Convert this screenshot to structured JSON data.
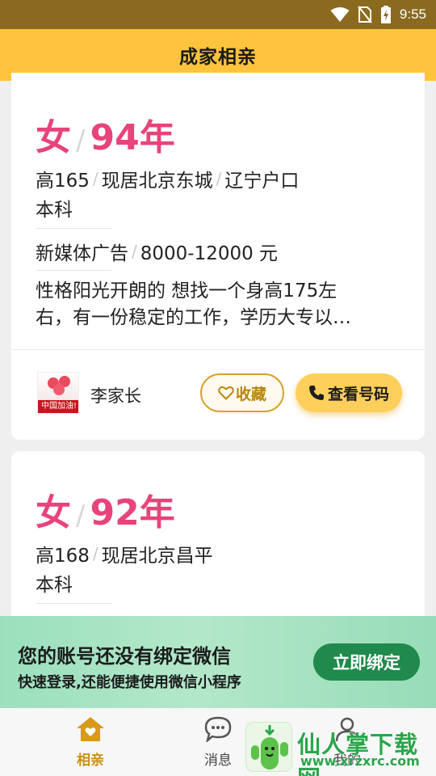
{
  "status_bar": {
    "time": "9:55",
    "icons": [
      "wifi-icon",
      "no-sim-icon",
      "battery-charging-icon"
    ]
  },
  "app_bar": {
    "title": "成家相亲"
  },
  "cards": [
    {
      "gender": "女",
      "birth_year": "94年",
      "height": "高165",
      "residence": "现居北京东城",
      "hukou": "辽宁户口",
      "education": "本科",
      "job": "新媒体广告",
      "income": "8000-12000 元",
      "desc_line1": "性格阳光开朗的 想找一个身高175左",
      "desc_line2": "右，有一份稳定的工作，学历大专以…",
      "poster": "李家长",
      "avatar_text": "中国加油!",
      "fav_label": "收藏",
      "call_label": "查看号码"
    },
    {
      "gender": "女",
      "birth_year": "92年",
      "height": "高168",
      "residence": "现居北京昌平",
      "education": "本科"
    }
  ],
  "bind_banner": {
    "title": "您的账号还没有绑定微信",
    "subtitle": "快速登录,还能便捷使用微信小程序",
    "button": "立即绑定"
  },
  "nav": [
    {
      "label": "相亲",
      "icon": "home-heart-icon",
      "active": true
    },
    {
      "label": "消息",
      "icon": "chat-bubble-icon",
      "active": false
    },
    {
      "label": "我的",
      "icon": "person-icon",
      "active": false
    }
  ],
  "watermark": {
    "text": "仙人掌下载网",
    "url": "www.xrzxrc.com",
    "logo": "cactus-logo-icon"
  },
  "colors": {
    "accent": "#ffc33d",
    "pink": "#e8437b",
    "green": "#1f8a4c"
  }
}
